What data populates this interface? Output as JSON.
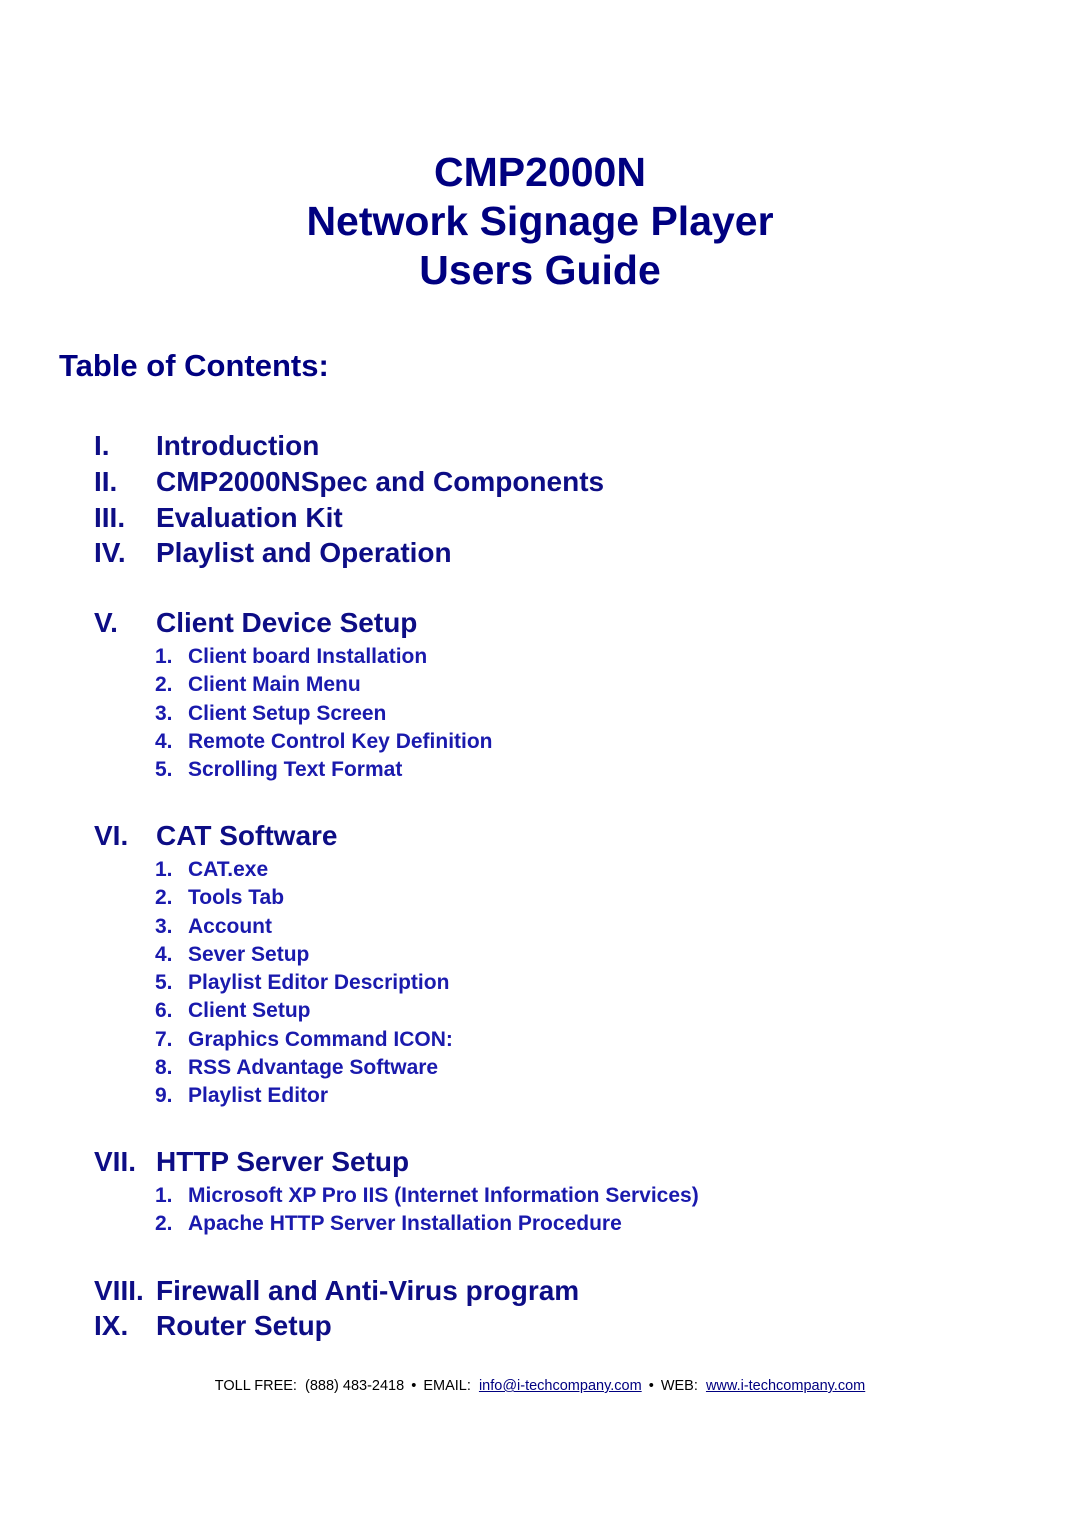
{
  "document": {
    "title_lines": [
      "CMP2000N",
      "Network Signage Player",
      "Users Guide"
    ],
    "toc_heading": "Table of Contents:",
    "colors": {
      "title": "#000080",
      "section": "#0d0d85",
      "subitem": "#1a1aad",
      "footer_text": "#000000",
      "footer_link": "#000080",
      "page_background": "#ffffff"
    }
  },
  "toc": {
    "sections": [
      {
        "num": "I.",
        "label": "Introduction",
        "subitems": []
      },
      {
        "num": "II.",
        "label": "CMP2000NSpec and Components",
        "subitems": []
      },
      {
        "num": "III.",
        "label": "Evaluation Kit",
        "subitems": []
      },
      {
        "num": "IV.",
        "label": "Playlist and Operation",
        "subitems": []
      },
      {
        "num": "V.",
        "label": "Client Device Setup",
        "subitems": [
          {
            "num": "1.",
            "label": "Client board Installation"
          },
          {
            "num": "2.",
            "label": "Client Main Menu"
          },
          {
            "num": "3.",
            "label": "Client Setup Screen"
          },
          {
            "num": "4.",
            "label": "Remote Control Key Definition"
          },
          {
            "num": "5.",
            "label": "Scrolling Text Format"
          }
        ]
      },
      {
        "num": "VI.",
        "label": "CAT Software",
        "subitems": [
          {
            "num": "1.",
            "label": "CAT.exe"
          },
          {
            "num": "2.",
            "label": "Tools Tab"
          },
          {
            "num": "3.",
            "label": "Account"
          },
          {
            "num": "4.",
            "label": "Sever Setup"
          },
          {
            "num": "5.",
            "label": "Playlist Editor Description"
          },
          {
            "num": "6.",
            "label": "Client Setup"
          },
          {
            "num": "7.",
            "label": "Graphics Command ICON:"
          },
          {
            "num": "8.",
            "label": "RSS Advantage Software"
          },
          {
            "num": "9.",
            "label": "Playlist Editor"
          }
        ]
      },
      {
        "num": "VII.",
        "label": "HTTP Server Setup",
        "subitems": [
          {
            "num": "1.",
            "label": "Microsoft XP Pro IIS (Internet Information Services)"
          },
          {
            "num": "2.",
            "label": "Apache HTTP Server Installation Procedure"
          }
        ]
      },
      {
        "num": "VIII.",
        "label": "Firewall and Anti-Virus program",
        "subitems": []
      },
      {
        "num": "IX.",
        "label": "Router Setup",
        "subitems": []
      }
    ]
  },
  "footer": {
    "toll_free_label": "TOLL FREE:",
    "toll_free_value": "(888) 483-2418",
    "separator": "•",
    "email_label": "EMAIL:",
    "email_value": "info@i-techcompany.com",
    "web_label": "WEB:",
    "web_value": "www.i-techcompany.com"
  }
}
